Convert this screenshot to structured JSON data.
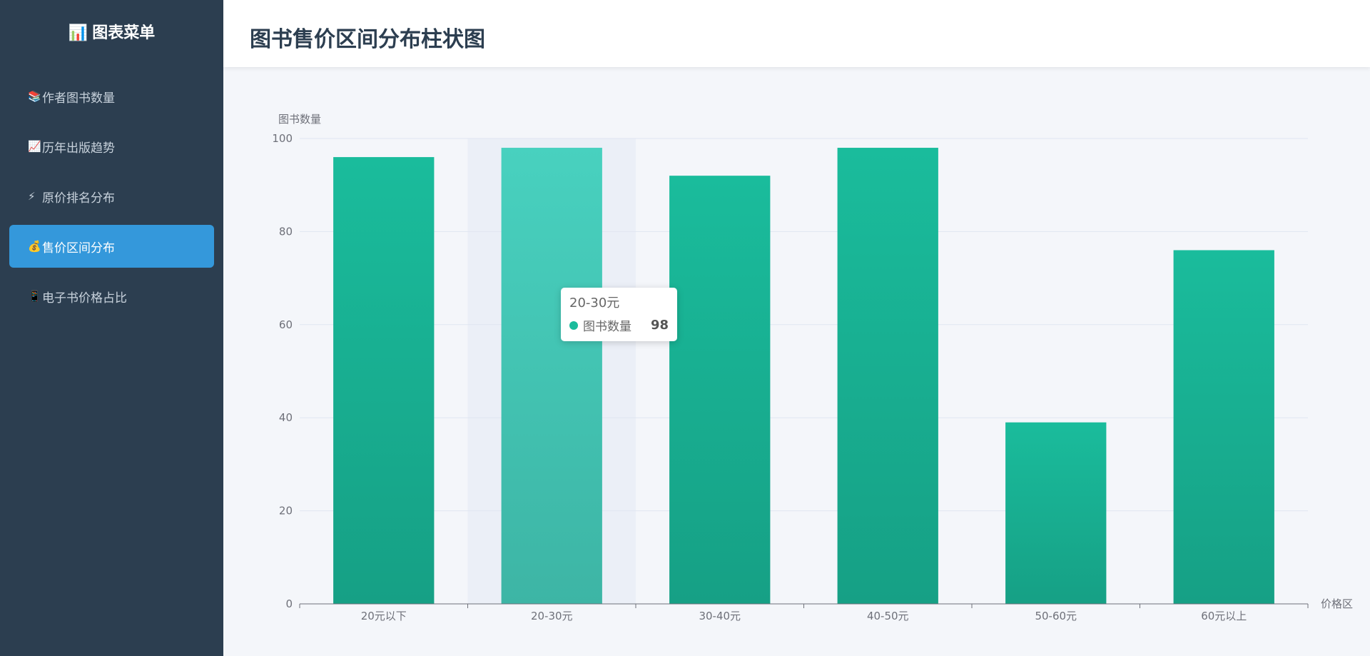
{
  "sidebar": {
    "title": "图表菜单",
    "title_icon": "📊",
    "items": [
      {
        "icon": "📚",
        "label": "作者图书数量",
        "active": false
      },
      {
        "icon": "📈",
        "label": "历年出版趋势",
        "active": false
      },
      {
        "icon": "⚡",
        "label": "原价排名分布",
        "active": false
      },
      {
        "icon": "💰",
        "label": "售价区间分布",
        "active": true
      },
      {
        "icon": "📱",
        "label": "电子书价格占比",
        "active": false
      }
    ]
  },
  "header": {
    "title": "图书售价区间分布柱状图"
  },
  "colors": {
    "bar_top": "#1abc9c",
    "bar_bottom": "#16a085",
    "bar_hover_top": "#48d1bf",
    "bar_hover_bottom": "#3db5a5",
    "active": "#3498db",
    "sidebar": "#2c3e50"
  },
  "chart_data": {
    "type": "bar",
    "categories": [
      "20元以下",
      "20-30元",
      "30-40元",
      "40-50元",
      "50-60元",
      "60元以上"
    ],
    "series": [
      {
        "name": "图书数量",
        "values": [
          96,
          98,
          92,
          98,
          39,
          76
        ]
      }
    ],
    "xlabel": "价格区",
    "ylabel": "图书数量",
    "ylim": [
      0,
      100
    ],
    "yticks": [
      0,
      20,
      40,
      60,
      80,
      100
    ],
    "grid": true,
    "highlighted_index": 1
  },
  "tooltip": {
    "title": "20-30元",
    "series_name": "图书数量",
    "value": "98"
  }
}
